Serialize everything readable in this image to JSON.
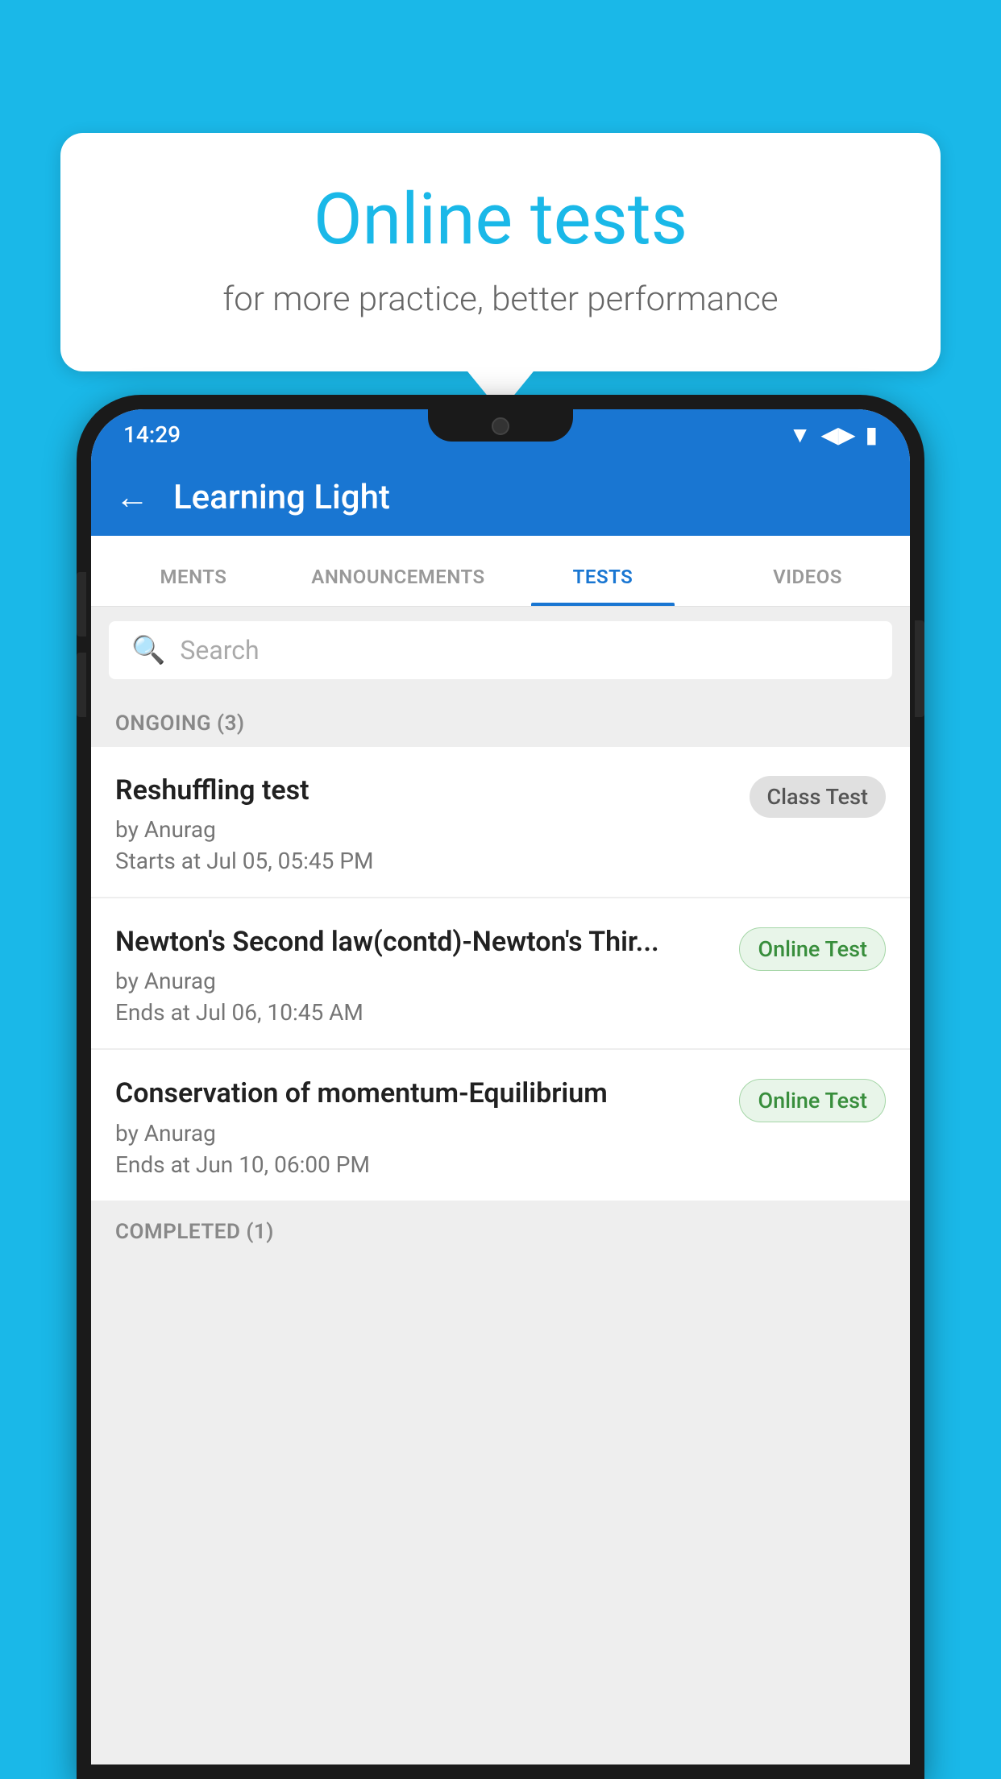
{
  "background_color": "#1ab8e8",
  "speech_bubble": {
    "title": "Online tests",
    "subtitle": "for more practice, better performance"
  },
  "status_bar": {
    "time": "14:29",
    "wifi": "▼",
    "signal": "▲",
    "battery": "▮"
  },
  "app_bar": {
    "back_label": "←",
    "title": "Learning Light"
  },
  "tabs": [
    {
      "label": "MENTS",
      "active": false
    },
    {
      "label": "ANNOUNCEMENTS",
      "active": false
    },
    {
      "label": "TESTS",
      "active": true
    },
    {
      "label": "VIDEOS",
      "active": false
    }
  ],
  "search": {
    "placeholder": "Search"
  },
  "ongoing_section": {
    "header": "ONGOING (3)",
    "tests": [
      {
        "title": "Reshuffling test",
        "author": "by Anurag",
        "date": "Starts at  Jul 05, 05:45 PM",
        "badge": "Class Test",
        "badge_type": "class"
      },
      {
        "title": "Newton's Second law(contd)-Newton's Thir...",
        "author": "by Anurag",
        "date": "Ends at  Jul 06, 10:45 AM",
        "badge": "Online Test",
        "badge_type": "online"
      },
      {
        "title": "Conservation of momentum-Equilibrium",
        "author": "by Anurag",
        "date": "Ends at  Jun 10, 06:00 PM",
        "badge": "Online Test",
        "badge_type": "online"
      }
    ]
  },
  "completed_section": {
    "header": "COMPLETED (1)"
  }
}
